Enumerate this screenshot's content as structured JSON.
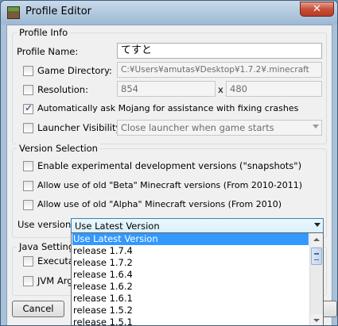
{
  "window": {
    "title": "Profile Editor",
    "close_symbol": "✕"
  },
  "profile_info": {
    "group_title": "Profile Info",
    "name_label": "Profile Name:",
    "name_value": "てすと",
    "game_directory": {
      "label": "Game Directory:",
      "checked": false,
      "value": "C:¥Users¥amutas¥Desktop¥1.7.2¥.minecraft"
    },
    "resolution": {
      "label": "Resolution:",
      "checked": false,
      "width": "854",
      "separator": "x",
      "height": "480"
    },
    "auto_ask": {
      "label": "Automatically ask Mojang for assistance with fixing crashes",
      "checked": true
    },
    "launcher_visibility": {
      "label": "Launcher Visibility:",
      "checked": false,
      "value": "Close launcher when game starts"
    }
  },
  "version_selection": {
    "group_title": "Version Selection",
    "snapshots": {
      "label": "Enable experimental development versions (\"snapshots\")",
      "checked": false
    },
    "beta": {
      "label": "Allow use of old \"Beta\" Minecraft versions (From 2010-2011)",
      "checked": false
    },
    "alpha": {
      "label": "Allow use of old \"Alpha\" Minecraft versions (From 2010)",
      "checked": false
    },
    "use_version_label": "Use version:",
    "use_version_value": "Use Latest Version"
  },
  "dropdown": {
    "items": [
      "Use Latest Version",
      "release 1.7.4",
      "release 1.7.2",
      "release 1.6.4",
      "release 1.6.2",
      "release 1.6.1",
      "release 1.5.2",
      "release 1.5.1"
    ],
    "selected_index": 0
  },
  "java_settings": {
    "group_title_partial": "Java Setting",
    "executable_partial": "Executab",
    "jvm_args_partial": "JVM Arg"
  },
  "buttons": {
    "cancel": "Cancel"
  },
  "colors": {
    "selection": "#3399ff",
    "window_frame": "#a9c1d9",
    "close_button": "#c7503a"
  },
  "icons": [
    "app-icon",
    "close-icon",
    "checkbox-check-icon",
    "combo-arrow-icon",
    "scroll-up-icon",
    "scroll-down-icon"
  ]
}
